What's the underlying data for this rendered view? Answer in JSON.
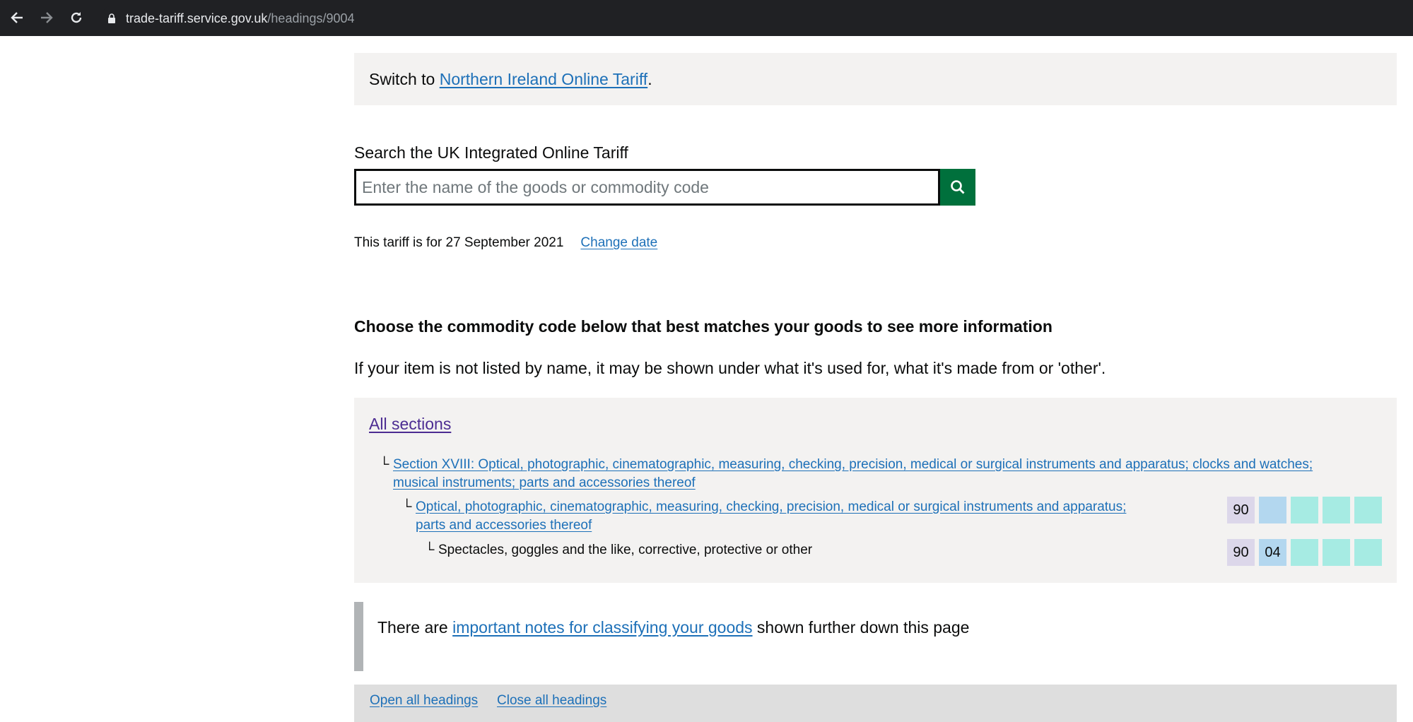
{
  "browser": {
    "url_host": "trade-tariff.service.gov.uk",
    "url_path": "/headings/9004"
  },
  "banner": {
    "prefix": "Switch to ",
    "link": "Northern Ireland Online Tariff",
    "suffix": "."
  },
  "search": {
    "label": "Search the UK Integrated Online Tariff",
    "placeholder": "Enter the name of the goods or commodity code"
  },
  "date": {
    "text": "This tariff is for 27 September 2021",
    "change_link": "Change date"
  },
  "main": {
    "heading": "Choose the commodity code below that best matches your goods to see more information",
    "hint": "If your item is not listed by name, it may be shown under what it's used for, what it's made from or 'other'."
  },
  "tree": {
    "all_sections": "All sections",
    "bracket": "└",
    "section_line1": "Section XVIII: Optical, photographic, cinematographic, measuring, checking, precision, medical or surgical instruments and apparatus; clocks and watches;",
    "section_line2": "musical instruments; parts and accessories thereof",
    "chapter_line1": "Optical, photographic, cinematographic, measuring, checking, precision, medical or surgical instruments and apparatus;",
    "chapter_line2": "parts and accessories thereof",
    "heading": "Spectacles, goggles and the like, corrective, protective or other",
    "chapter_code": "90",
    "heading_codes": [
      "90",
      "04"
    ]
  },
  "notes": {
    "prefix": "There are ",
    "link": "important notes for classifying your goods",
    "suffix": " shown further down this page"
  },
  "headings_controls": {
    "open_all": "Open all headings",
    "close_all": "Close all headings"
  },
  "colors": {
    "link": "#1d70b8",
    "visited_link": "#4c2c92",
    "search_button": "#00703c",
    "panel_bg": "#f3f2f1",
    "code_chapter": "#dcd7ea",
    "code_heading": "#b3d7ef",
    "code_sub": "#a6ebe3"
  },
  "icons": {
    "back": "arrow-left-icon",
    "forward": "arrow-right-icon",
    "reload": "reload-icon",
    "lock": "lock-icon",
    "search": "search-icon"
  }
}
